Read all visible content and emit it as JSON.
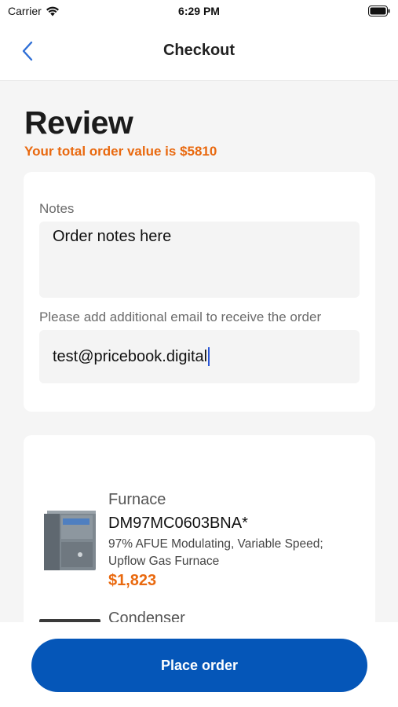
{
  "status_bar": {
    "carrier": "Carrier",
    "time": "6:29 PM",
    "icons": [
      "wifi-icon",
      "battery-icon"
    ]
  },
  "nav": {
    "title": "Checkout",
    "back_icon": "chevron-left-icon",
    "accent_color": "#2f6fd6"
  },
  "review": {
    "title": "Review",
    "total_text": "Your total order value is $5810",
    "total_color": "#e9690f"
  },
  "notes": {
    "label": "Notes",
    "value": "Order notes here",
    "email_label": "Please add additional email to receive the order",
    "email_value": "test@pricebook.digital"
  },
  "products": [
    {
      "category": "Furnace",
      "model": "DM97MC0603BNA*",
      "description": "97% AFUE Modulating, Variable Speed; Upflow Gas Furnace",
      "price": "$1,823",
      "image_icon": "furnace-image"
    },
    {
      "category": "Condenser",
      "image_icon": "condenser-image"
    }
  ],
  "actions": {
    "place_order_label": "Place order",
    "button_color": "#0556b8"
  }
}
